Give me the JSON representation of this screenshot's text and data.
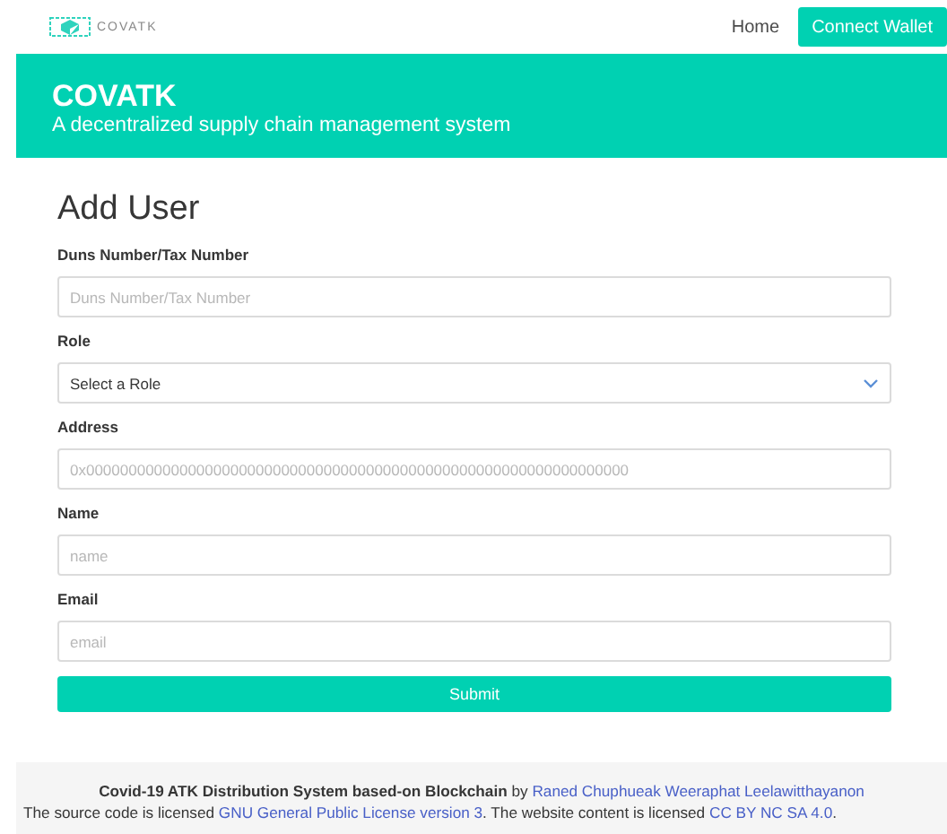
{
  "nav": {
    "logo_text": "COVATK",
    "links": [
      {
        "label": "Home",
        "kind": "link"
      },
      {
        "label": "Connect Wallet",
        "kind": "button"
      }
    ]
  },
  "hero": {
    "title": "COVATK",
    "subtitle": "A decentralized supply chain management system"
  },
  "form": {
    "title": "Add User",
    "fields": [
      {
        "label": "Duns Number/Tax Number",
        "kind": "input",
        "placeholder": "Duns Number/Tax Number"
      },
      {
        "label": "Role",
        "kind": "select",
        "value": "Select a Role"
      },
      {
        "label": "Address",
        "kind": "input",
        "placeholder": "0x0000000000000000000000000000000000000000000000000000000000000000"
      },
      {
        "label": "Name",
        "kind": "input",
        "placeholder": "name"
      },
      {
        "label": "Email",
        "kind": "input",
        "placeholder": "email"
      }
    ],
    "submit": "Submit"
  },
  "footer": {
    "title": "Covid-19 ATK Distribution System based-on Blockchain",
    "by": "by",
    "authors": "Raned Chuphueak Weeraphat Leelawitthayanon",
    "license_prefix": "The source code is licensed",
    "code_license": "GNU General Public License version 3",
    "license_middle": ". The website content is licensed",
    "content_license": "CC BY NC SA 4.0",
    "license_end": "."
  }
}
